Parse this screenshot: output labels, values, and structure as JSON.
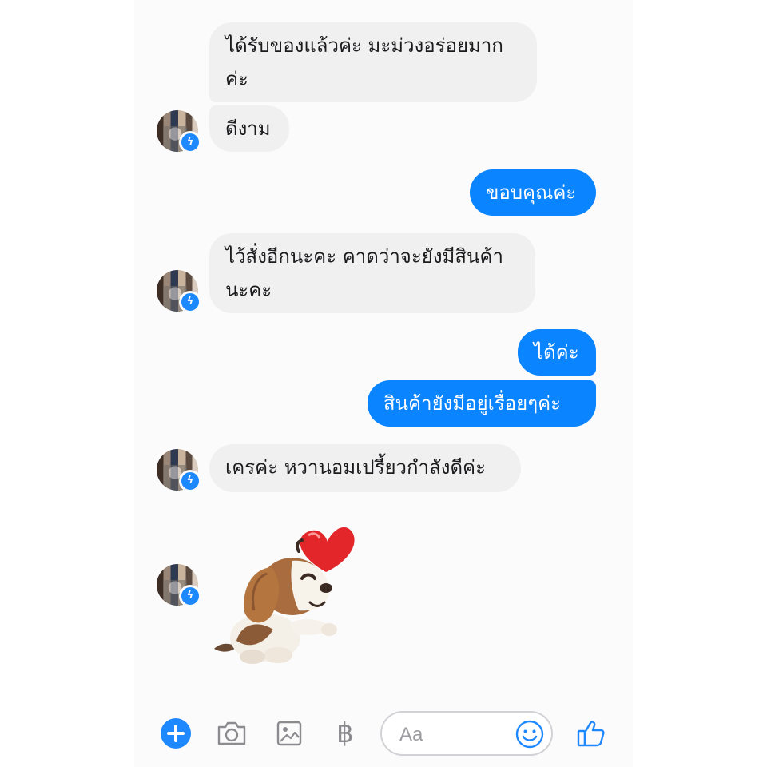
{
  "conversation": {
    "messages": [
      {
        "side": "in",
        "text": "ได้รับของแล้วค่ะ มะม่วงอร่อยมาก"
      },
      {
        "side": "in",
        "text": "ค่ะ"
      },
      {
        "side": "in",
        "text": "ดีงาม"
      },
      {
        "side": "out",
        "text": "ขอบคุณค่ะ"
      },
      {
        "side": "in",
        "text": "ไว้สั่งอีกนะคะ คาดว่าจะยังมีสินค้า"
      },
      {
        "side": "in",
        "text": "นะคะ"
      },
      {
        "side": "out",
        "text": "ได้ค่ะ"
      },
      {
        "side": "out",
        "text": "สินค้ายังมีอยู่เรื่อยๆค่ะ"
      },
      {
        "side": "in",
        "text": "เครค่ะ หวานอมเปรี้ยวกำลังดีค่ะ"
      }
    ],
    "sticker": {
      "description": "beagle-heart-sticker"
    }
  },
  "colors": {
    "outgoing_bubble": "#0a84ff",
    "incoming_bubble": "#f0f0f1",
    "accent": "#1e88ff"
  },
  "composer": {
    "placeholder": "Aa",
    "icons": [
      "plus-icon",
      "camera-icon",
      "image-icon",
      "baht-icon",
      "emoji-icon",
      "thumbs-up-icon"
    ]
  }
}
